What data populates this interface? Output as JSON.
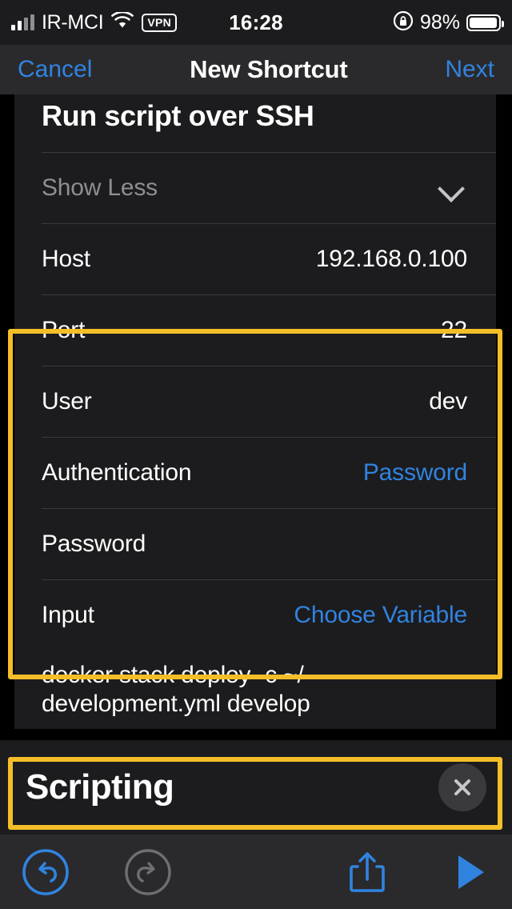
{
  "statusbar": {
    "carrier": "IR-MCI",
    "vpn_badge": "VPN",
    "time": "16:28",
    "battery_percent": "98%",
    "signal_icon": "cellular-signal-icon",
    "wifi_icon": "wifi-icon",
    "orientation_lock_icon": "rotation-lock-icon",
    "battery_icon": "battery-icon"
  },
  "navbar": {
    "cancel_label": "Cancel",
    "title": "New Shortcut",
    "next_label": "Next"
  },
  "action": {
    "title": "Run script over SSH",
    "show_less_label": "Show Less",
    "chevron_icon": "chevron-down-icon",
    "fields": [
      {
        "label": "Host",
        "value": "192.168.0.100",
        "style": "plain"
      },
      {
        "label": "Port",
        "value": "22",
        "style": "plain"
      },
      {
        "label": "User",
        "value": "dev",
        "style": "plain"
      },
      {
        "label": "Authentication",
        "value": "Password",
        "style": "link"
      },
      {
        "label": "Password",
        "value": "",
        "style": "plain"
      }
    ],
    "input": {
      "label": "Input",
      "value": "Choose Variable",
      "style": "link"
    },
    "script": "docker stack deploy -c ~/\ndevelopment.yml develop"
  },
  "highlights": {
    "color": "#F5BE28",
    "boxes": [
      {
        "name": "ssh-credentials-highlight"
      },
      {
        "name": "script-text-highlight"
      }
    ]
  },
  "panel": {
    "title": "Scripting",
    "close_icon": "close-icon"
  },
  "toolbar": {
    "undo_icon": "undo-icon",
    "redo_icon": "redo-icon",
    "share_icon": "share-icon",
    "run_icon": "play-icon"
  },
  "colors": {
    "accent_blue": "#3183E0",
    "highlight_yellow": "#F5BE28",
    "card_background": "#1C1C1E",
    "disabled_gray": "#6E6E73"
  }
}
